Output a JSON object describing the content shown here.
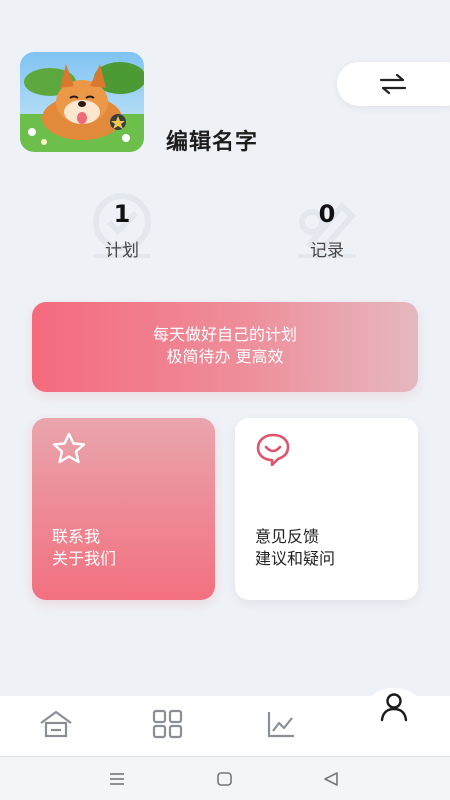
{
  "profile": {
    "username": "编辑名字"
  },
  "stats": [
    {
      "value": "1",
      "label": "计划"
    },
    {
      "value": "0",
      "label": "记录"
    }
  ],
  "banner": {
    "line1": "每天做好自己的计划",
    "line2": "极简待办 更高效"
  },
  "cards": {
    "contact": {
      "line1": "联系我",
      "line2": "关于我们",
      "icon": "star-icon"
    },
    "feedback": {
      "line1": "意见反馈",
      "line2": "建议和疑问",
      "icon": "smile-chat-icon"
    }
  },
  "tabbar": {
    "items": [
      {
        "icon": "home-icon"
      },
      {
        "icon": "grid-icon"
      },
      {
        "icon": "chart-icon"
      },
      {
        "icon": "person-icon",
        "active": true
      }
    ]
  },
  "colors": {
    "accent": "#f2707f",
    "background": "#eef2f7",
    "feedback_icon": "#e0546a"
  }
}
